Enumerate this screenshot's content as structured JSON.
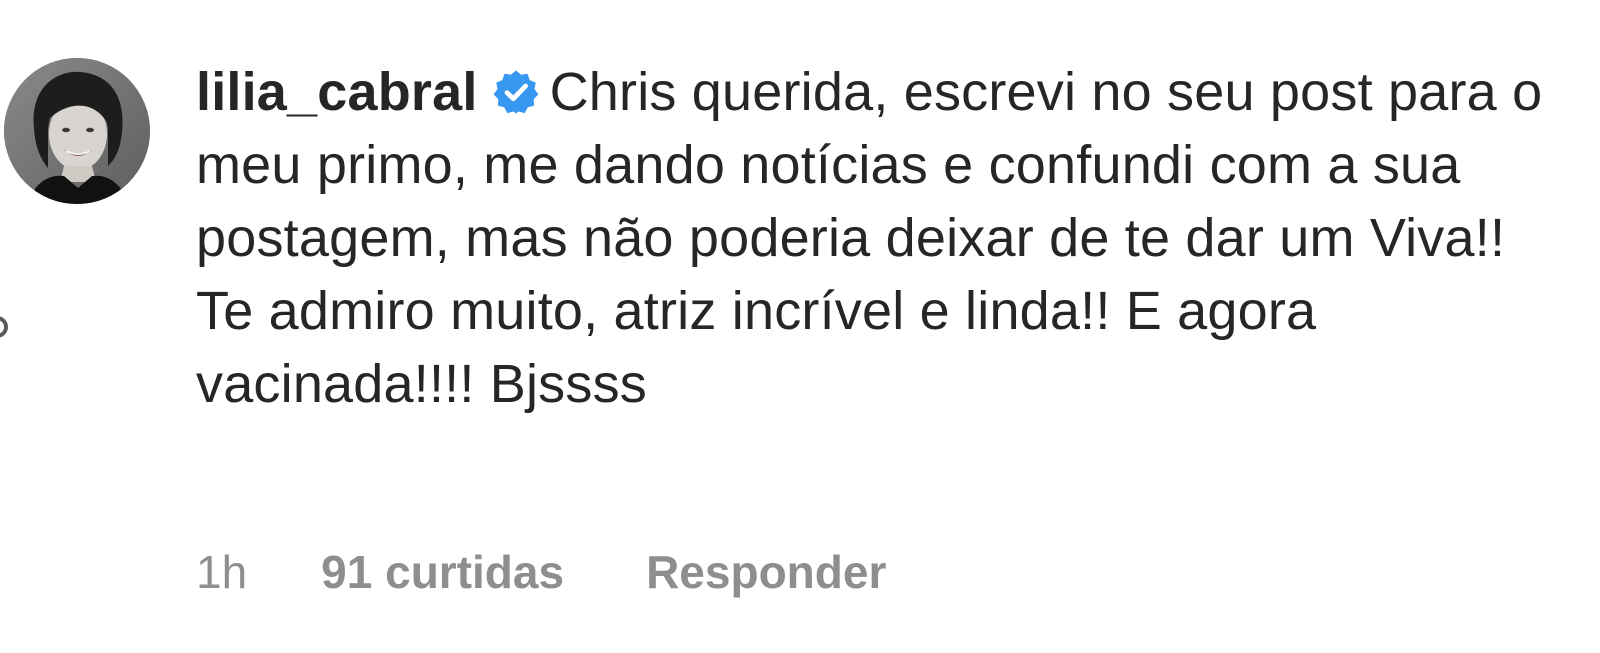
{
  "comment": {
    "username": "lilia_cabral",
    "verified_icon": "verified-badge-icon",
    "text": "Chris querida, escrevi no seu post para o meu primo, me dando notícias e confundi com a sua postagem, mas não poderia deixar de te dar um Viva!! Te admiro muito, atriz incrível e linda!! E agora vacinada!!!! Bjssss",
    "time": "1h",
    "likes": "91 curtidas",
    "reply_label": "Responder"
  },
  "colors": {
    "text": "#262626",
    "meta": "#8e8e8e",
    "verified_blue": "#3897f0"
  }
}
